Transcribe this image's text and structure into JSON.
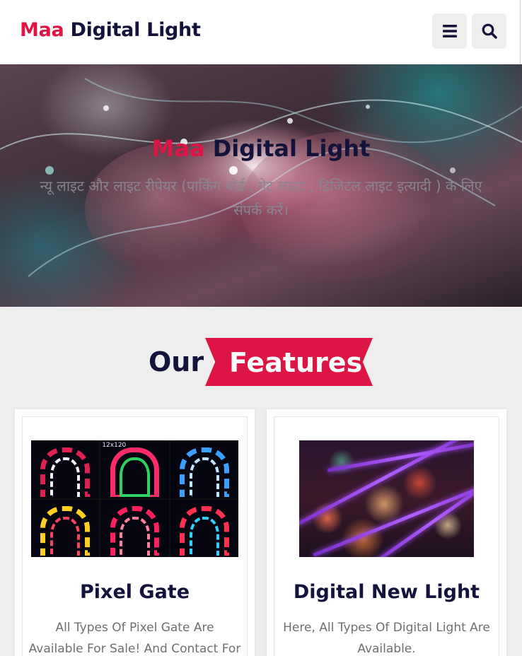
{
  "header": {
    "brand_accent": "Maa",
    "brand_rest": "Digital Light",
    "menu_icon": "bars-icon",
    "search_icon": "search-icon"
  },
  "hero": {
    "title_accent": "Maa",
    "title_rest": "Digital Light",
    "subtitle": "न्यू लाइट और लाइट रीपेयर (पार्किंग बोर्ड , गेट लाइट , डिजिटल लाइट इत्यादी ) के लिए संपर्क करें।"
  },
  "features": {
    "heading_plain": "Our",
    "heading_badge": "Features"
  },
  "cards": [
    {
      "title": "Pixel Gate",
      "text": "All Types Of Pixel Gate Are Available For Sale! And Contact For",
      "image_label": "12x120"
    },
    {
      "title": "Digital New Light",
      "text": "Here, All Types Of Digital Light Are Available."
    }
  ],
  "colors": {
    "accent": "#dc1544",
    "navy": "#14133b",
    "background": "#eeeeee"
  }
}
